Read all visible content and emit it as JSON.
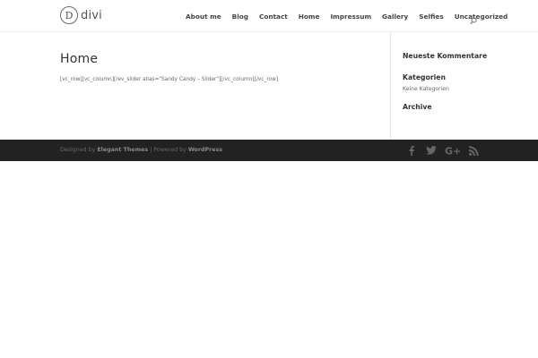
{
  "logo": {
    "mark": "D",
    "text": "divi"
  },
  "nav": {
    "items": [
      {
        "label": "About me"
      },
      {
        "label": "Blog"
      },
      {
        "label": "Contact"
      },
      {
        "label": "Home"
      },
      {
        "label": "Impressum"
      },
      {
        "label": "Gallery"
      },
      {
        "label": "Selfies"
      },
      {
        "label": "Uncategorized"
      }
    ],
    "search_icon": "search-icon"
  },
  "main": {
    "title": "Home",
    "content": "[vc_row][vc_column][rev_slider alias=\"Sandy Candy – Slider\"][/vc_column][/vc_row]"
  },
  "sidebar": {
    "widgets": [
      {
        "title": "Neueste Kommentare"
      },
      {
        "title": "Kategorien",
        "text": "Keine Kategorien"
      },
      {
        "title": "Archive"
      }
    ]
  },
  "footer": {
    "designed_by": "Designed by",
    "theme_link": "Elegant Themes",
    "separator": "| Powered by",
    "wp_link": "WordPress",
    "social_icons": [
      "facebook-icon",
      "twitter-icon",
      "google-plus-icon",
      "rss-icon"
    ]
  },
  "colors": {
    "footer_bg": "#222222",
    "icon_color": "#666666",
    "text_dark": "#333333"
  }
}
